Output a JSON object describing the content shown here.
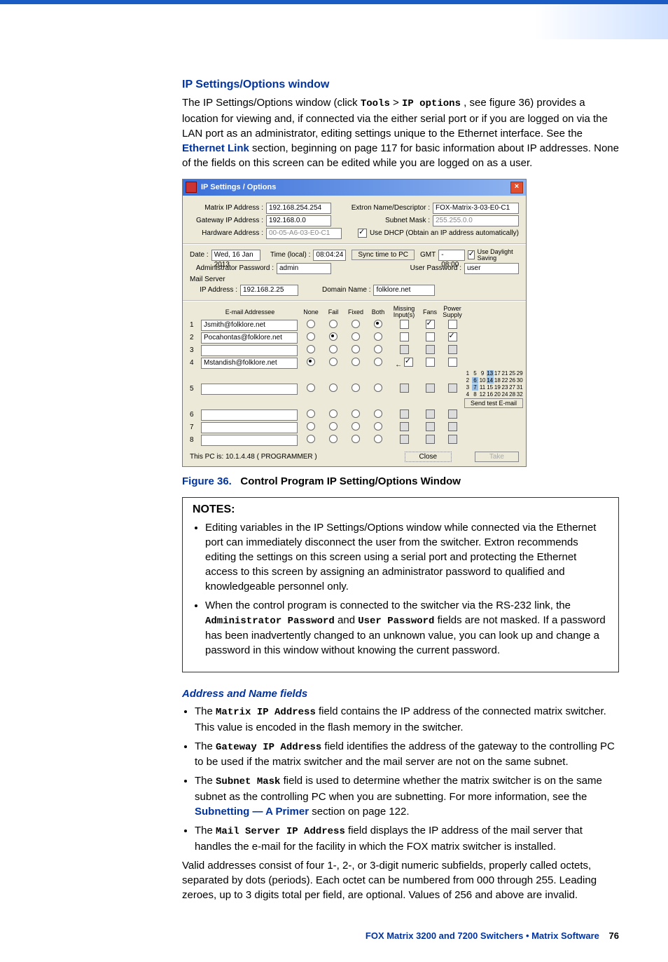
{
  "headings": {
    "ip_settings": "IP Settings/Options window",
    "address_name": "Address and Name fields"
  },
  "intro": {
    "p1a": "The IP Settings/Options window (click ",
    "tools": "Tools",
    "gt": " > ",
    "ipopt": "IP options",
    "p1b": ", see figure 36) provides a location for viewing and, if connected via the either serial port or if you are logged on via the LAN port as an administrator, editing settings unique to the Ethernet interface. See the ",
    "ethlink": "Ethernet Link",
    "p1c": " section, beginning on page 117 for basic information about IP addresses. None of the fields on this screen can be edited while you are logged on as a user."
  },
  "figure": {
    "num": "Figure 36.",
    "title": "Control Program IP Setting/Options Window"
  },
  "notes": {
    "title": "NOTES:",
    "n1": "Editing variables in the IP Settings/Options window while connected via the Ethernet port can immediately disconnect the user from the switcher. Extron recommends editing the settings on this screen using a serial port and protecting the Ethernet access to this screen by assigning an administrator password to qualified and knowledgeable personnel only.",
    "n2a": "When the control program is connected to the switcher via the RS-232 link, the ",
    "admin_pw": "Administrator Password",
    "and": " and ",
    "user_pw": "User Password",
    "n2b": " fields are not masked. If a password has been inadvertently changed to an unknown value, you can look up and change a password in this window without knowing the current password."
  },
  "fields": {
    "f1a": "The ",
    "matrix_ip": "Matrix IP Address",
    "f1b": " field contains the IP address of the connected matrix switcher. This value is encoded in the flash memory in the switcher.",
    "gateway_ip": "Gateway IP Address",
    "f2b": " field identifies the address of the gateway to the controlling PC to be used if the matrix switcher and the mail server are not on the same subnet.",
    "subnet_mask": "Subnet Mask",
    "f3b": " field is used to determine whether the matrix switcher is on the same subnet as the controlling PC when you are subnetting. For more information, see the ",
    "subnet_link": "Subnetting — A Primer",
    "f3c": " section on page 122.",
    "mail_ip": "Mail Server IP Address",
    "f4b": " field displays the IP address of the mail server that handles the e-mail for the facility in which the FOX matrix switcher is installed."
  },
  "valid": "Valid addresses consist of four 1-, 2-, or 3-digit numeric subfields, properly called octets, separated by dots (periods). Each octet can be numbered from 000 through 255. Leading zeroes, up to 3 digits total per field, are optional. Values of 256 and above are invalid.",
  "footer": {
    "text": "FOX Matrix 3200 and 7200 Switchers • Matrix Software",
    "page": "76"
  },
  "dialog": {
    "title": "IP Settings / Options",
    "labels": {
      "matrix_ip": "Matrix IP Address :",
      "gateway_ip": "Gateway IP Address :",
      "hardware": "Hardware Address :",
      "extron_name": "Extron Name/Descriptor :",
      "subnet_mask": "Subnet Mask :",
      "use_dhcp": "Use DHCP   (Obtain an IP address automatically)",
      "date": "Date :",
      "time_local": "Time (local) :",
      "sync": "Sync time to PC",
      "gmt": "GMT",
      "daylight": "Use Daylight Saving",
      "admin_pw": "Administrator Password :",
      "user_pw": "User Password :",
      "mail_server": "Mail Server",
      "ip_addr": "IP Address :",
      "domain": "Domain Name :",
      "email_addr": "E-mail Addressee",
      "none": "None",
      "fail": "Fail",
      "fixed": "Fixed",
      "both": "Both",
      "missing": "Missing Input(s)",
      "fans": "Fans",
      "power": "Power Supply",
      "send_test": "Send test E-mail",
      "this_pc": "This PC is:   10.1.4.48   ( PROGRAMMER  )",
      "close": "Close",
      "take": "Take"
    },
    "values": {
      "matrix_ip": "192.168.254.254",
      "gateway_ip": "192.168.0.0",
      "hardware": "00-05-A6-03-E0-C1",
      "extron_name": "FOX-Matrix-3-03-E0-C1",
      "subnet_mask": "255.255.0.0",
      "date": "Wed, 16 Jan 2013",
      "time": "08:04:24",
      "gmt_off": "- 08:00",
      "admin_pw": "admin",
      "user_pw": "user",
      "mail_ip": "192.168.2.25",
      "domain": "folklore.net"
    },
    "emails": {
      "rows": [
        {
          "n": "1",
          "addr": "Jsmith@folklore.net",
          "sel": "both",
          "missing": false,
          "fans": true,
          "power": false
        },
        {
          "n": "2",
          "addr": "Pocahontas@folklore.net",
          "sel": "fail",
          "missing": false,
          "fans": false,
          "power": true
        },
        {
          "n": "3",
          "addr": "",
          "sel": "",
          "missing": false,
          "fans": false,
          "power": false
        },
        {
          "n": "4",
          "addr": "Mstandish@folklore.net",
          "sel": "none",
          "missing": true,
          "fans": false,
          "power": false,
          "arrow": true
        },
        {
          "n": "5",
          "addr": "",
          "sel": "",
          "missing": false,
          "fans": false,
          "power": false
        },
        {
          "n": "6",
          "addr": "",
          "sel": "",
          "missing": false,
          "fans": false,
          "power": false
        },
        {
          "n": "7",
          "addr": "",
          "sel": "",
          "missing": false,
          "fans": false,
          "power": false
        },
        {
          "n": "8",
          "addr": "",
          "sel": "",
          "missing": false,
          "fans": false,
          "power": false
        }
      ]
    }
  }
}
